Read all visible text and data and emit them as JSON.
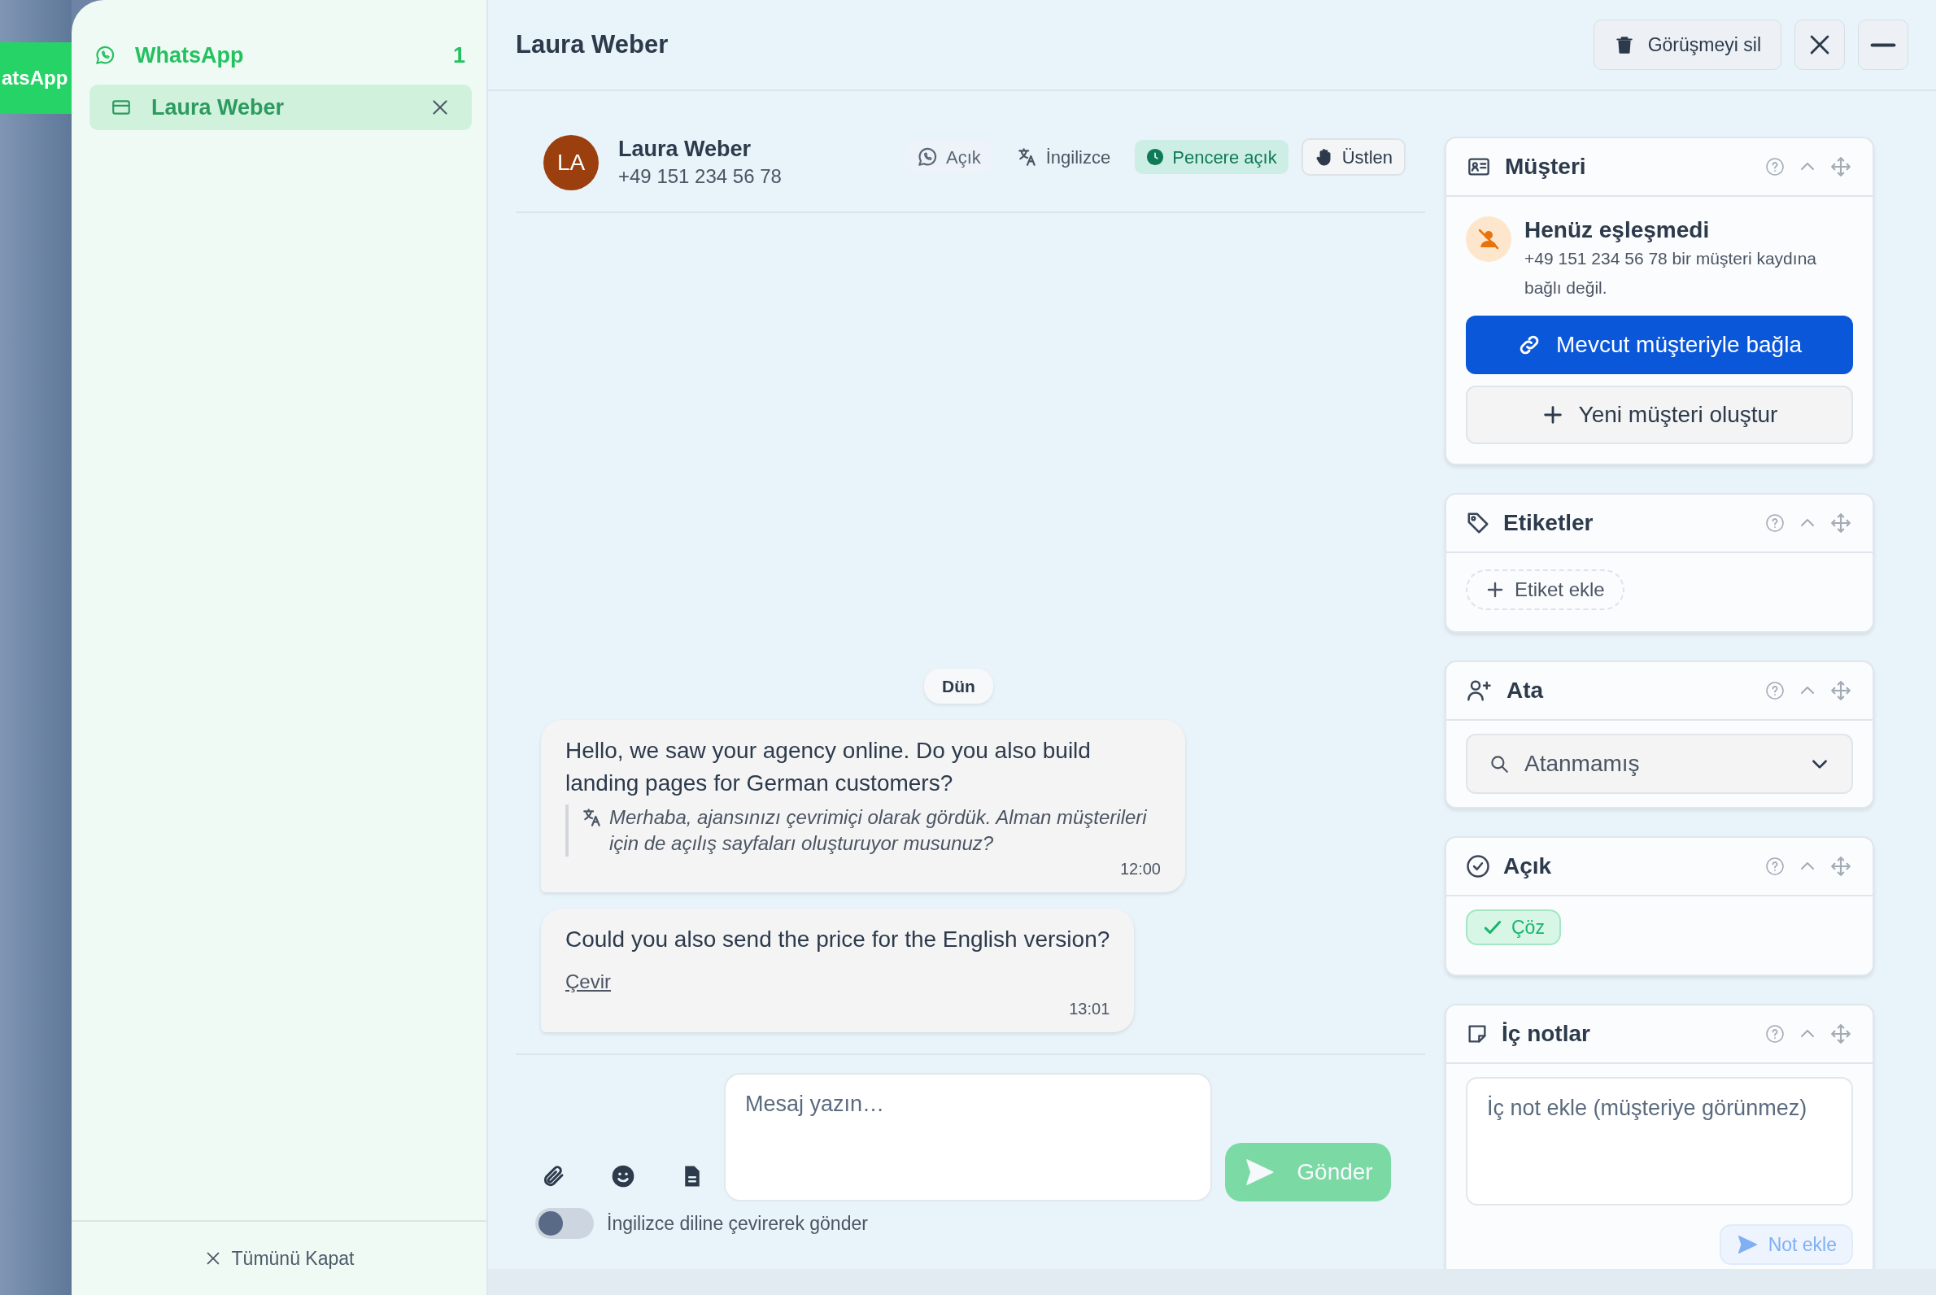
{
  "background_tab": {
    "label": "atsApp"
  },
  "sidebar": {
    "channel": {
      "name": "WhatsApp",
      "count": "1"
    },
    "conversations": [
      {
        "name": "Laura Weber",
        "selected": true
      }
    ],
    "close_all": "Tümünü Kapat"
  },
  "header": {
    "title": "Laura Weber",
    "delete_button": "Görüşmeyi sil"
  },
  "contact": {
    "initials": "LA",
    "name": "Laura Weber",
    "phone": "+49 151 234 56 78",
    "chips": [
      {
        "kind": "channel",
        "label": "Açık"
      },
      {
        "kind": "language",
        "label": "İngilizce"
      },
      {
        "kind": "window",
        "label": "Pencere açık"
      },
      {
        "kind": "claim",
        "label": "Üstlen"
      }
    ]
  },
  "messages": [
    {
      "kind": "date",
      "text": "Dün"
    },
    {
      "kind": "incoming",
      "text": "Hello, we saw your agency online. Do you also build landing pages for German customers?",
      "translation": "Merhaba, ajansınızı çevrimiçi olarak gördük. Alman müşterileri için de açılış sayfaları oluşturuyor musunuz?",
      "time": "12:00"
    },
    {
      "kind": "incoming",
      "text": "Could you also send the price for the English version?",
      "translate_link": "Çevir",
      "time": "13:01"
    }
  ],
  "composer": {
    "placeholder": "Mesaj yazın…",
    "send": {
      "label": "Gönder",
      "disabled": true
    },
    "translate_toggle": {
      "label": "İngilizce diline çevirerek gönder",
      "on": false
    }
  },
  "panels": [
    {
      "kind": "customer",
      "title": "Müşteri",
      "status_title": "Henüz eşleşmedi",
      "status_text": "+49 151 234 56 78 bir müşteri kaydına bağlı değil.",
      "link_button": "Mevcut müşteriyle bağla",
      "create_button": "Yeni müşteri oluştur"
    },
    {
      "kind": "tags",
      "title": "Etiketler",
      "add_button": "Etiket ekle"
    },
    {
      "kind": "assign",
      "title": "Ata",
      "value": "Atanmamış"
    },
    {
      "kind": "status",
      "title": "Açık",
      "resolve_button": "Çöz"
    },
    {
      "kind": "notes",
      "title": "İç notlar",
      "placeholder": "İç not ekle (müşteriye görünmez)",
      "add_button": {
        "label": "Not ekle",
        "disabled": true
      }
    }
  ]
}
